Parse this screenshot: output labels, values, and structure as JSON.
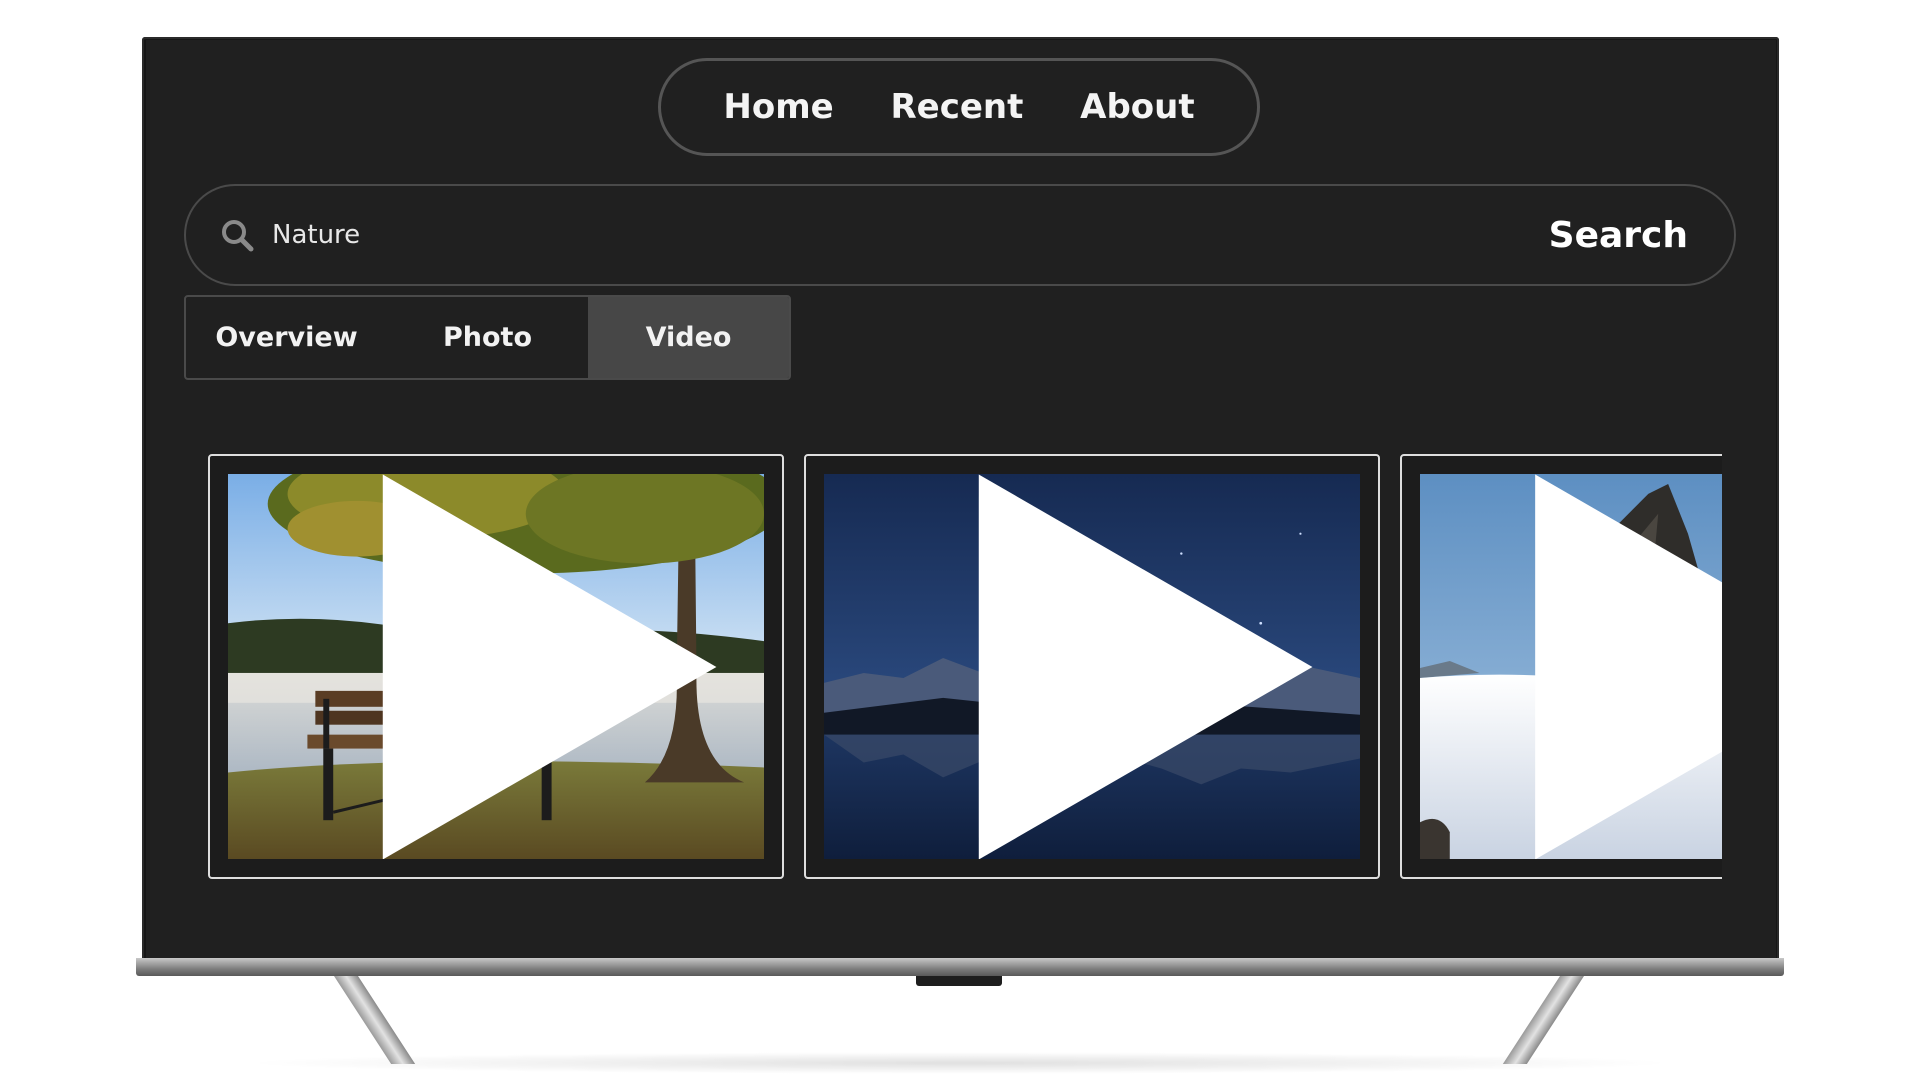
{
  "nav": {
    "items": [
      {
        "label": "Home"
      },
      {
        "label": "Recent"
      },
      {
        "label": "About"
      }
    ]
  },
  "search": {
    "value": "Nature",
    "button_label": "Search",
    "icon": "search-icon"
  },
  "tabs": {
    "items": [
      {
        "label": "Overview",
        "active": false
      },
      {
        "label": "Photo",
        "active": false
      },
      {
        "label": "Video",
        "active": true
      }
    ]
  },
  "videos": [
    {
      "scene": "lake-bench-tree",
      "icon": "play-icon"
    },
    {
      "scene": "night-mountain-lake",
      "icon": "play-icon"
    },
    {
      "scene": "rock-above-clouds",
      "icon": "play-icon"
    }
  ],
  "colors": {
    "screen_bg": "#202020",
    "border": "#4a4a4a",
    "active_tab": "#474747",
    "text": "#f4f4f4"
  }
}
